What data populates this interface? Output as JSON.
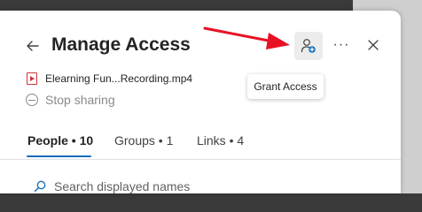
{
  "dialog": {
    "title": "Manage Access",
    "file_name": "Elearning Fun...Recording.mp4",
    "stop_sharing": "Stop sharing",
    "grant_tooltip": "Grant Access",
    "more_label": "···"
  },
  "tabs": [
    {
      "label": "People • 10",
      "active": true
    },
    {
      "label": "Groups • 1",
      "active": false
    },
    {
      "label": "Links • 4",
      "active": false
    }
  ],
  "search": {
    "placeholder": "Search displayed names"
  },
  "icons": {
    "back": "back-arrow-icon",
    "grant": "grant-access-icon",
    "more": "more-options-icon",
    "close": "close-icon",
    "file": "video-file-icon",
    "stop": "stop-sharing-icon",
    "search": "search-icon"
  },
  "colors": {
    "accent": "#0f6cbd",
    "annotation_arrow": "#e81123",
    "file_icon": "#d13438"
  }
}
